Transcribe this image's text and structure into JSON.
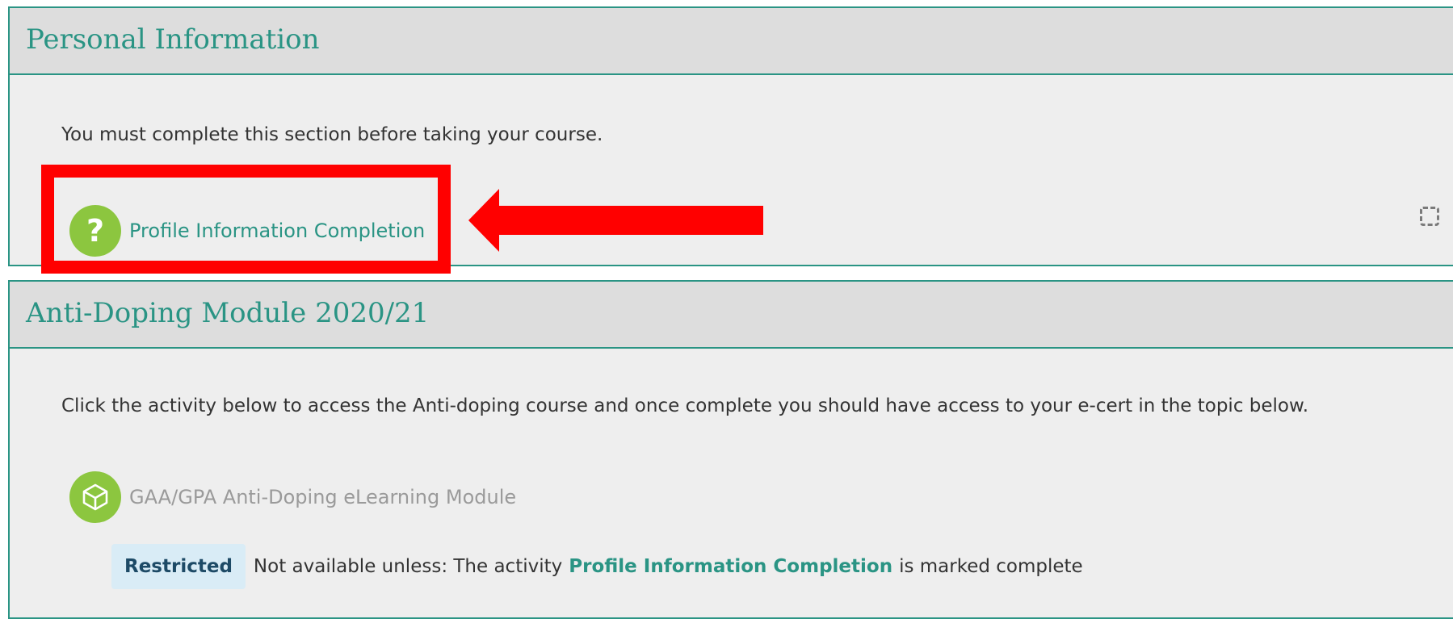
{
  "sections": [
    {
      "title": "Personal Information",
      "summary": "You must complete this section before taking your course.",
      "activity": {
        "label": "Profile Information Completion",
        "icon": "question-mark-icon",
        "completion": "completion-checkbox-icon"
      }
    },
    {
      "title": "Anti-Doping Module 2020/21",
      "summary": "Click the activity below to access the Anti-doping course and once complete you should have access to your e-cert in the topic below.",
      "activity": {
        "label": "GAA/GPA Anti-Doping eLearning Module",
        "icon": "cube-icon"
      },
      "restriction": {
        "badge": "Restricted",
        "prefix": "Not available unless: The activity",
        "link": "Profile Information Completion",
        "suffix": "is marked complete"
      }
    }
  ],
  "annotation": {
    "highlight_color": "#ff0000",
    "arrow": "left-arrow"
  },
  "colors": {
    "accent": "#2a9484",
    "icon_green": "#8cc63f",
    "header_bg": "#dddddd",
    "body_bg": "#eeeeee"
  }
}
